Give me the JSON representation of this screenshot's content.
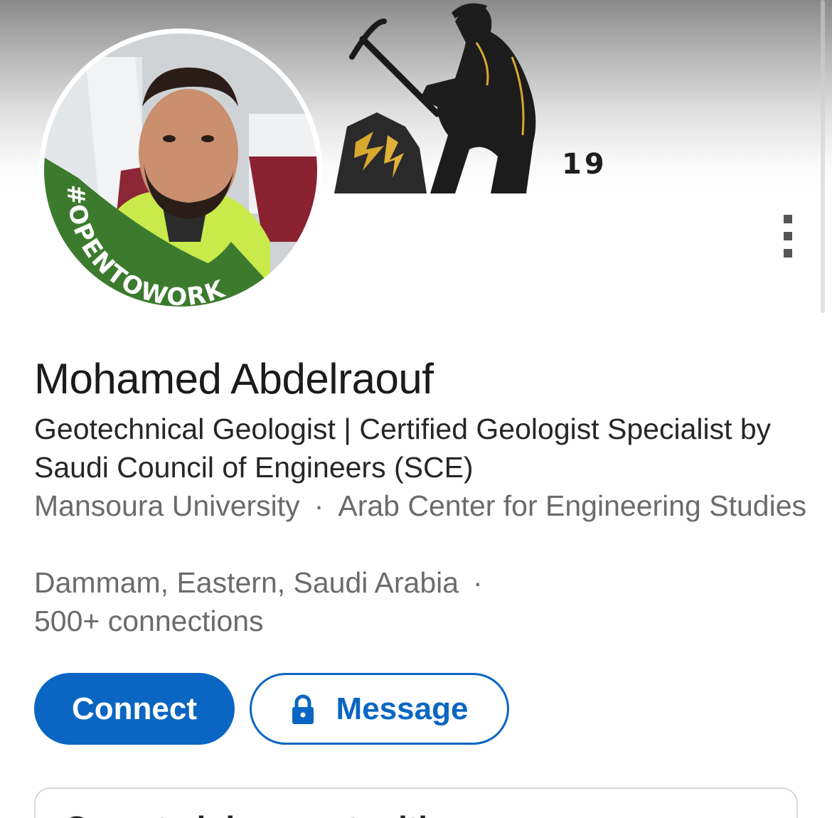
{
  "banner": {
    "number": "19"
  },
  "avatar": {
    "badge_text": "#OPENTOWORK",
    "badge_color": "#3c7a2e"
  },
  "profile": {
    "name": "Mohamed Abdelraouf",
    "headline": "Geotechnical Geologist | Certified Geologist Specialist by Saudi Council of Engineers (SCE)",
    "education": "Mansoura University",
    "dot": "·",
    "company": "Arab Center for Engineering Studies",
    "location": "Dammam, Eastern, Saudi Arabia",
    "connections": "500+ connections"
  },
  "actions": {
    "connect_label": "Connect",
    "message_label": "Message",
    "accent": "#0a66c2"
  },
  "card": {
    "title": "Open to job opportunities"
  },
  "icons": {
    "more": "vertical-ellipsis-icon",
    "lock": "lock-icon"
  }
}
